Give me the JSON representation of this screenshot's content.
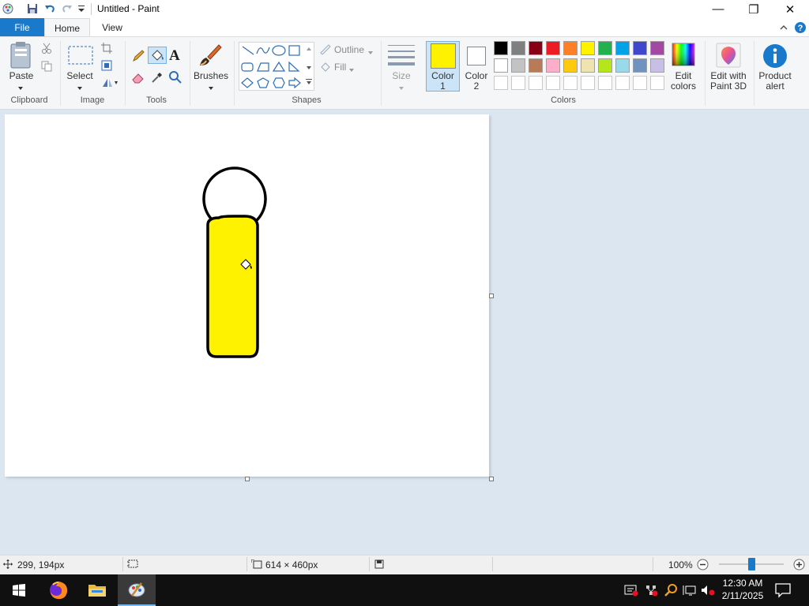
{
  "window": {
    "title": "Untitled - Paint",
    "minimize_glyph": "—",
    "restore_glyph": "❐",
    "close_glyph": "✕"
  },
  "tabs": {
    "file": "File",
    "home": "Home",
    "view": "View"
  },
  "ribbon": {
    "clipboard": {
      "paste": "Paste",
      "group": "Clipboard"
    },
    "image": {
      "select": "Select",
      "group": "Image"
    },
    "tools": {
      "text_glyph": "A",
      "group": "Tools"
    },
    "brushes": {
      "label": "Brushes"
    },
    "shapes": {
      "outline": "Outline",
      "fill": "Fill",
      "group": "Shapes"
    },
    "size": {
      "label": "Size"
    },
    "color1": {
      "label_line1": "Color",
      "label_line2": "1",
      "value": "#fff200"
    },
    "color2": {
      "label_line1": "Color",
      "label_line2": "2",
      "value": "#ffffff"
    },
    "colors_group": "Colors",
    "palette_row1": [
      "#000000",
      "#7f7f7f",
      "#880015",
      "#ed1c24",
      "#ff7f27",
      "#fff200",
      "#22b14c",
      "#00a2e8",
      "#3f48cc",
      "#a349a4"
    ],
    "palette_row2": [
      "#ffffff",
      "#c3c3c3",
      "#b97a57",
      "#ffaec9",
      "#ffc90e",
      "#efe4b0",
      "#b5e61d",
      "#99d9ea",
      "#7092be",
      "#c8bfe7"
    ],
    "edit_colors": {
      "line1": "Edit",
      "line2": "colors"
    },
    "paint3d": {
      "line1": "Edit with",
      "line2": "Paint 3D"
    },
    "product_alert": {
      "line1": "Product",
      "line2": "alert"
    }
  },
  "canvas": {
    "fill_color": "#fff200",
    "stroke_color": "#000000"
  },
  "status": {
    "cursor_pos": "299, 194px",
    "canvas_size": "614 × 460px",
    "zoom": "100%",
    "zoom_level": 0.5
  },
  "taskbar": {
    "time": "12:30 AM",
    "date": "2/11/2025"
  },
  "icons": [
    "paint-app-icon",
    "save-icon",
    "undo-icon",
    "redo-icon",
    "customize-quick-access-icon",
    "help-icon",
    "collapse-ribbon-icon",
    "paste-icon",
    "cut-icon",
    "copy-icon",
    "select-icon",
    "crop-icon",
    "resize-icon",
    "rotate-icon",
    "pencil-icon",
    "fill-bucket-icon",
    "text-icon",
    "eraser-icon",
    "color-picker-icon",
    "magnifier-icon",
    "brush-icon",
    "size-icon",
    "edit-colors-icon",
    "paint3d-icon",
    "product-alert-icon",
    "cursor-position-icon",
    "selection-size-icon",
    "canvas-size-icon",
    "disk-icon",
    "zoom-out-icon",
    "zoom-in-icon",
    "windows-start-icon",
    "firefox-icon",
    "file-explorer-icon",
    "paint-taskbar-icon",
    "notification-icon"
  ]
}
